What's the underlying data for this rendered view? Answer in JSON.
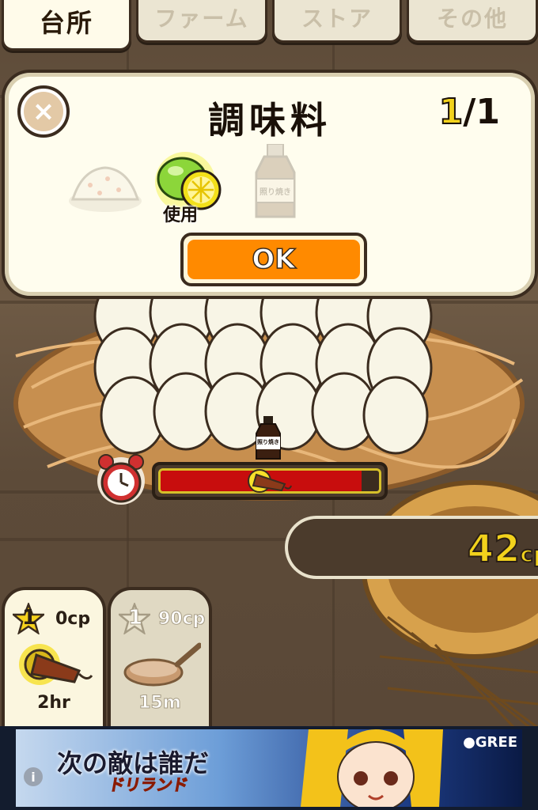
{
  "tabs": [
    {
      "label": "台所",
      "active": true
    },
    {
      "label": "ファーム",
      "active": false
    },
    {
      "label": "ストア",
      "active": false
    },
    {
      "label": "その他",
      "active": false
    }
  ],
  "modal": {
    "close_label": "×",
    "title": "調味料",
    "count_current": "1",
    "count_sep": "/",
    "count_total": "1",
    "items": [
      {
        "name": "rice",
        "state": "dimmed"
      },
      {
        "name": "lime",
        "state": "used"
      },
      {
        "name": "teriyaki-sauce",
        "state": "dimmed",
        "bottle_label": "照り焼き"
      }
    ],
    "used_label": "使用",
    "ok_label": "OK"
  },
  "progress": {
    "fraction": 0.92,
    "fill_color": "#c80d0d",
    "sauce_label": "照り焼き"
  },
  "cp": {
    "value": "42",
    "unit": "cp"
  },
  "cards": [
    {
      "level": "1",
      "cost": "0cp",
      "time": "2hr",
      "item": "lamp",
      "selected": true
    },
    {
      "level": "1",
      "cost": "90cp",
      "time": "15m",
      "item": "frying-pan",
      "selected": false
    }
  ],
  "ad": {
    "title": "次の敵は誰だ",
    "logo": "ドリランド",
    "brand": "●GREE",
    "info": "i"
  }
}
